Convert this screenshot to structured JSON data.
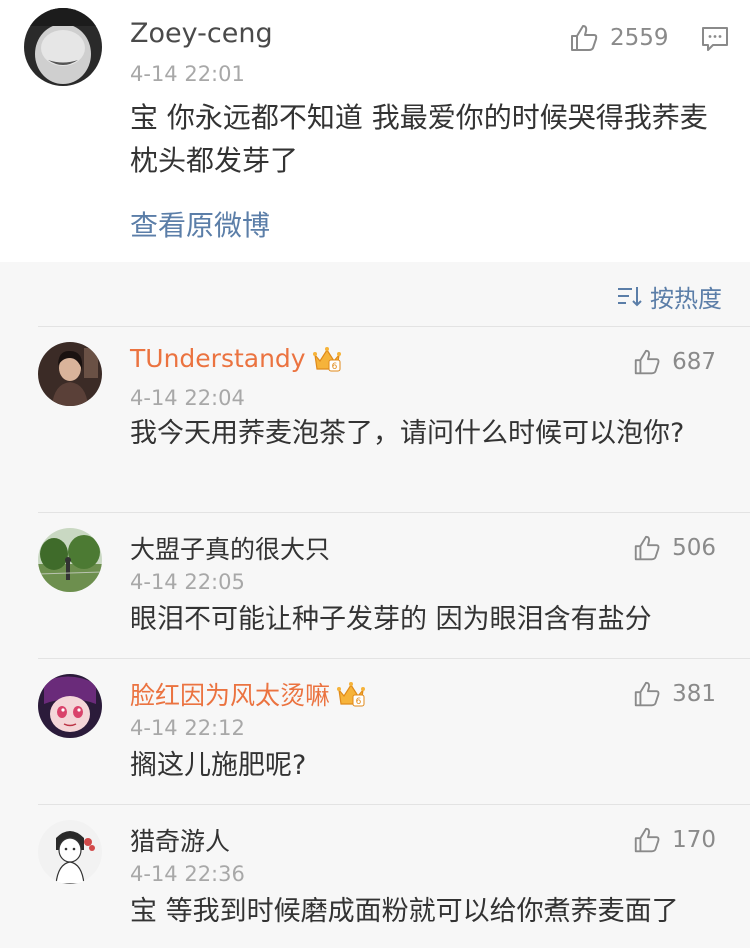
{
  "post": {
    "username": "Zoey-ceng",
    "time": "4-14 22:01",
    "likes": "2559",
    "text": "宝 你永远都不知道 我最爱你的时候哭得我荞麦枕头都发芽了",
    "view_original": "查看原微博"
  },
  "sort": {
    "label": "按热度"
  },
  "comments": [
    {
      "username": "TUnderstandy",
      "vip": true,
      "time": "4-14 22:04",
      "likes": "687",
      "text": "我今天用荞麦泡茶了，请问什么时候可以泡你?"
    },
    {
      "username": "大盟子真的很大只",
      "vip": false,
      "time": "4-14 22:05",
      "likes": "506",
      "text": "眼泪不可能让种子发芽的 因为眼泪含有盐分"
    },
    {
      "username": "脸红因为风太烫嘛",
      "vip": true,
      "time": "4-14 22:12",
      "likes": "381",
      "text": "搁这儿施肥呢?"
    },
    {
      "username": "猎奇游人",
      "vip": false,
      "time": "4-14 22:36",
      "likes": "170",
      "text": "宝 等我到时候磨成面粉就可以给你煮荞麦面了"
    }
  ],
  "colors": {
    "link": "#5b7ea8",
    "vip_name": "#eb7340",
    "comment_bg": "#f7f7f7",
    "muted": "#a8a8a8"
  },
  "icons": {
    "like": "thumbs-up-icon",
    "comment": "comment-icon",
    "sort": "sort-icon",
    "vip": "vip-crown-icon"
  }
}
